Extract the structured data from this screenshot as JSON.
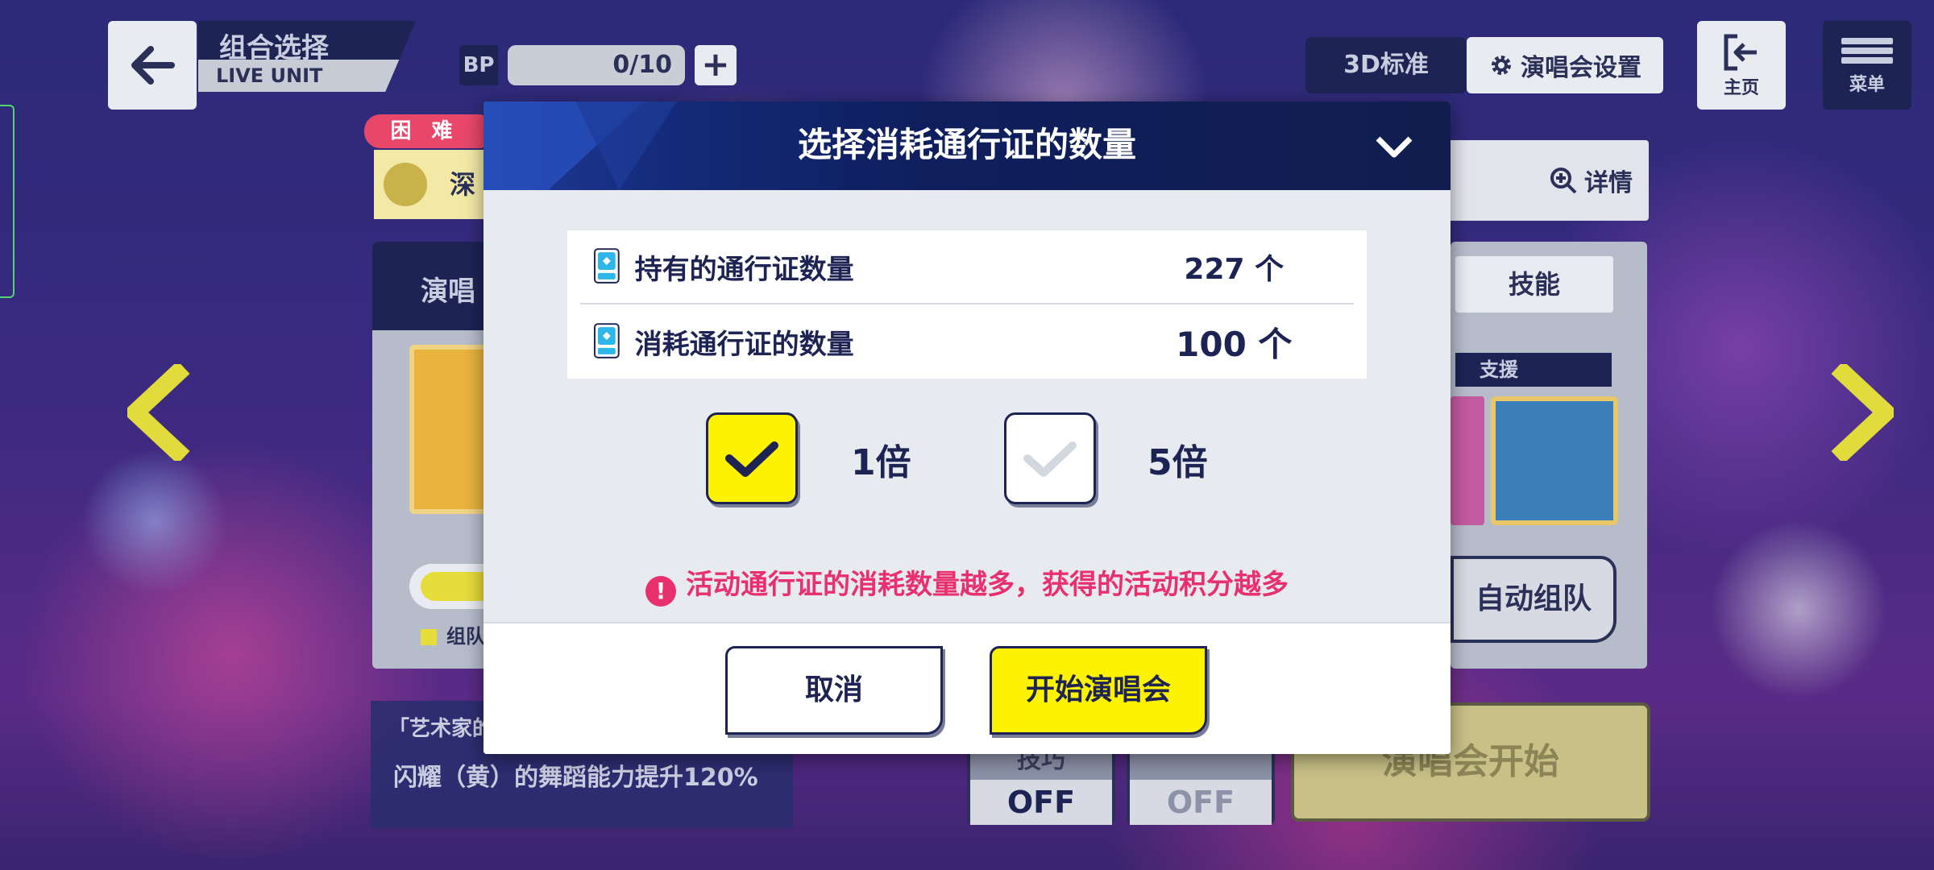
{
  "top_bar": {
    "unit_title": "组合选择",
    "unit_subtitle": "LIVE UNIT",
    "bp_label": "BP",
    "bp_value": "0/10",
    "mode_label": "3D标准",
    "settings_label": "演唱会设置",
    "home_label": "主页",
    "menu_label": "菜单"
  },
  "background": {
    "difficulty": "困 难",
    "song_partial": "深",
    "detail_label": "详情",
    "live_panel_partial": "演唱",
    "skill_label": "技能",
    "support_label": "支援",
    "legend_partial": "组队",
    "auto_team_label": "自动组队",
    "bonus_title_partial": "「艺术家的",
    "bonus_text": "闪耀（黄）的舞蹈能力提升120%",
    "toggle1_label": "技巧",
    "toggle1_value": "OFF",
    "toggle2_value": "OFF",
    "start_live_label": "演唱会开始"
  },
  "modal": {
    "title": "选择消耗通行证的数量",
    "owned_label": "持有的通行证数量",
    "owned_value": "227 个",
    "consume_label": "消耗通行证的数量",
    "consume_value": "100 个",
    "option_1x": "1倍",
    "option_5x": "5倍",
    "option_1x_checked": true,
    "option_5x_checked": false,
    "warning": "活动通行证的消耗数量越多，获得的活动积分越多",
    "warning_icon": "!",
    "cancel_label": "取消",
    "start_label": "开始演唱会"
  },
  "colors": {
    "navy": "#1d2454",
    "yellow": "#fdf200",
    "warning_pink": "#e8306e",
    "modal_bg": "#e7eaef"
  }
}
